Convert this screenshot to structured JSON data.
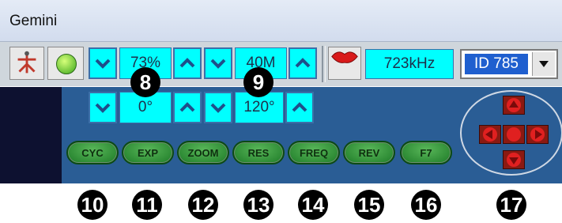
{
  "window": {
    "title": "Gemini"
  },
  "toolbar": {
    "gain_value": "73%",
    "depth_value": "40M",
    "freq_readout": "723kHz",
    "id_select": "ID 785"
  },
  "panel": {
    "angle_value": "0°",
    "beam_value": "120°",
    "buttons": [
      "CYC",
      "EXP",
      "ZOOM",
      "RES",
      "FREQ",
      "REV",
      "F7"
    ]
  },
  "callouts": {
    "top": [
      "8",
      "9"
    ],
    "bottom": [
      "10",
      "11",
      "12",
      "13",
      "14",
      "15",
      "16",
      "17"
    ]
  },
  "colors": {
    "panel_bg": "#2a5d95",
    "spin_bg": "#00ffff",
    "button_green": "#2f8f36",
    "dpad_red": "#e02020"
  }
}
